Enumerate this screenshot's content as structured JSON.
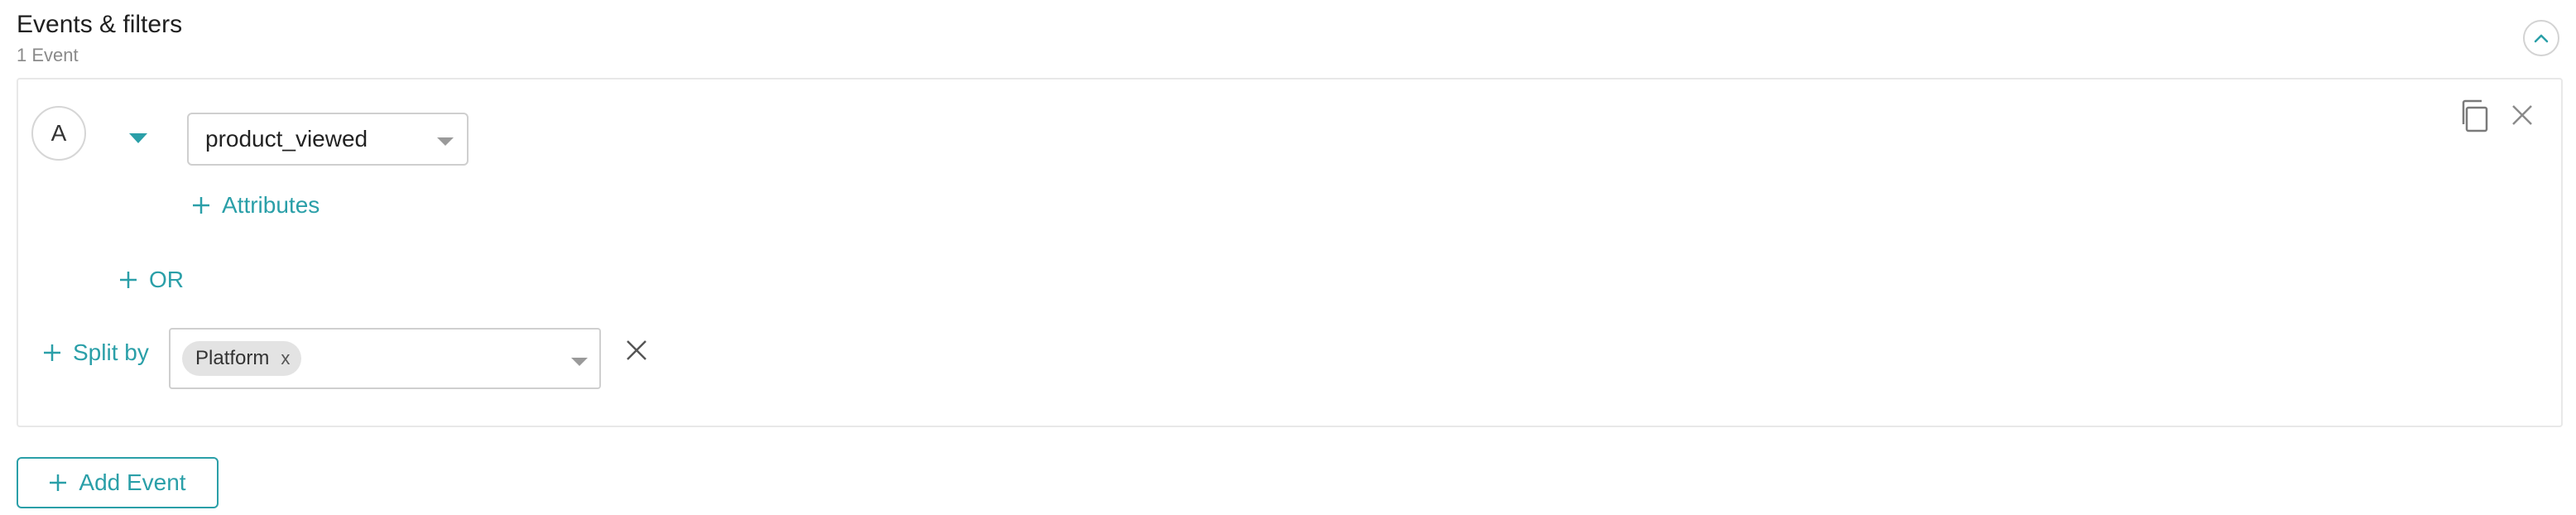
{
  "section": {
    "title": "Events & filters",
    "subtitle": "1 Event"
  },
  "event": {
    "letter": "A",
    "selected_event": "product_viewed",
    "attributes_label": "Attributes",
    "or_label": "OR"
  },
  "split": {
    "label": "Split by",
    "chips": [
      "Platform"
    ],
    "chip_remove_glyph": "x"
  },
  "footer": {
    "add_event_label": "Add Event"
  },
  "icons": {
    "collapse": "chevron-up-icon",
    "copy": "copy-icon",
    "close": "close-icon",
    "plus": "plus-icon",
    "caret": "caret-down-icon"
  },
  "colors": {
    "accent": "#2a9fa8",
    "border": "#cfcfcf",
    "chip_bg": "#e3e3e3"
  }
}
